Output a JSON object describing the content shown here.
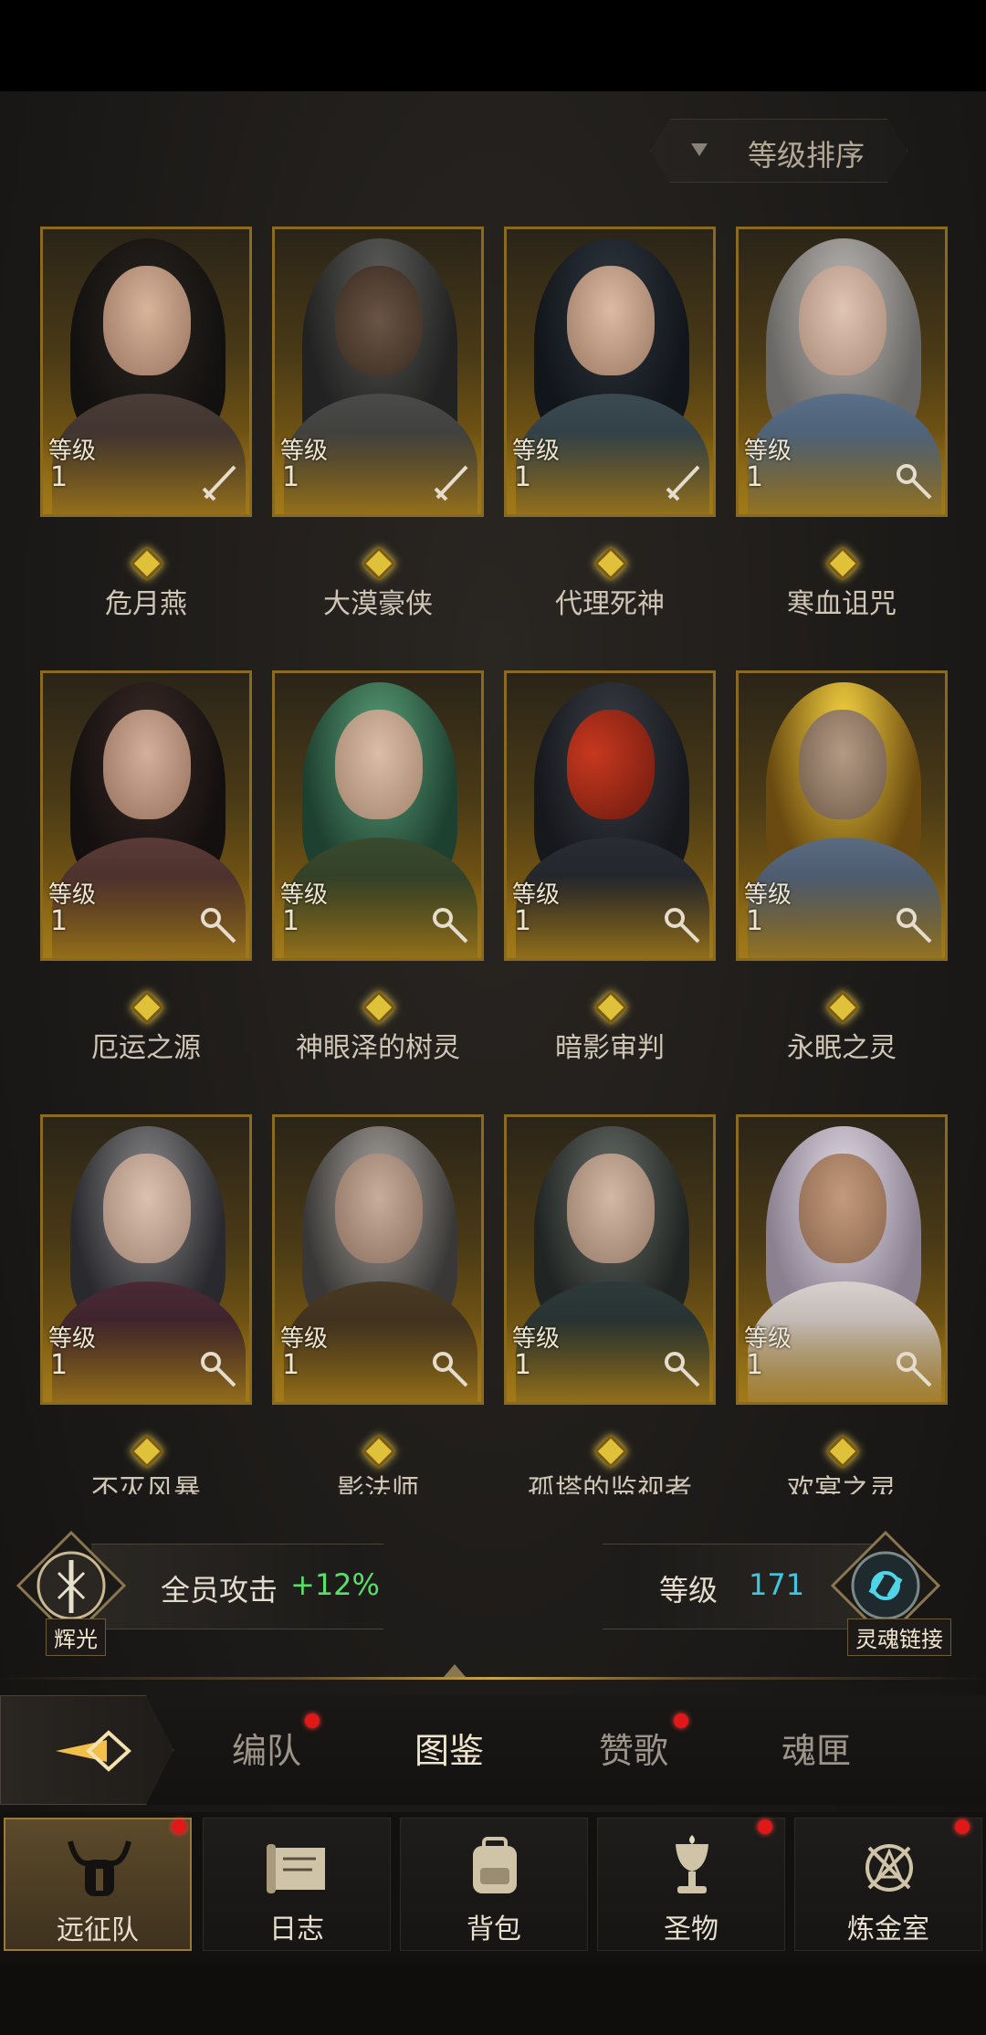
{
  "sort": {
    "label": "等级排序"
  },
  "cards": [
    {
      "name": "危月燕",
      "level_label": "等级",
      "level": "1",
      "class_icon": "sword-icon"
    },
    {
      "name": "大漠豪侠",
      "level_label": "等级",
      "level": "1",
      "class_icon": "sword-icon"
    },
    {
      "name": "代理死神",
      "level_label": "等级",
      "level": "1",
      "class_icon": "sword-icon"
    },
    {
      "name": "寒血诅咒",
      "level_label": "等级",
      "level": "1",
      "class_icon": "staff-icon"
    },
    {
      "name": "厄运之源",
      "level_label": "等级",
      "level": "1",
      "class_icon": "staff-icon"
    },
    {
      "name": "神眼泽的树灵",
      "level_label": "等级",
      "level": "1",
      "class_icon": "staff-icon"
    },
    {
      "name": "暗影审判",
      "level_label": "等级",
      "level": "1",
      "class_icon": "staff-icon"
    },
    {
      "name": "永眠之灵",
      "level_label": "等级",
      "level": "1",
      "class_icon": "staff-icon"
    },
    {
      "name": "不灭风暴",
      "level_label": "等级",
      "level": "1",
      "class_icon": "staff-icon"
    },
    {
      "name": "影法师",
      "level_label": "等级",
      "level": "1",
      "class_icon": "staff-icon"
    },
    {
      "name": "孤塔的监视者",
      "level_label": "等级",
      "level": "1",
      "class_icon": "staff-icon"
    },
    {
      "name": "欢宴之灵",
      "level_label": "等级",
      "level": "1",
      "class_icon": "staff-icon"
    }
  ],
  "bonus": {
    "emblem_label": "辉光",
    "text": "全员攻击",
    "value": "+12%"
  },
  "soul": {
    "level_label": "等级",
    "level": "171",
    "emblem_label": "灵魂链接"
  },
  "tabs": [
    {
      "label": "编队",
      "badge": true
    },
    {
      "label": "图鉴",
      "badge": false,
      "active": true
    },
    {
      "label": "赞歌",
      "badge": true
    },
    {
      "label": "魂匣",
      "badge": false
    }
  ],
  "nav": [
    {
      "label": "远征队",
      "icon": "horned-helmet-icon",
      "badge": true,
      "active": true
    },
    {
      "label": "日志",
      "icon": "scroll-icon",
      "badge": false
    },
    {
      "label": "背包",
      "icon": "backpack-icon",
      "badge": false
    },
    {
      "label": "圣物",
      "icon": "chalice-icon",
      "badge": true
    },
    {
      "label": "炼金室",
      "icon": "alchemy-icon",
      "badge": true
    }
  ],
  "colors": {
    "accent_gold": "#c9a44a",
    "bonus_green": "#59e06a",
    "level_cyan": "#3ec7e0",
    "badge_red": "#e01818"
  }
}
